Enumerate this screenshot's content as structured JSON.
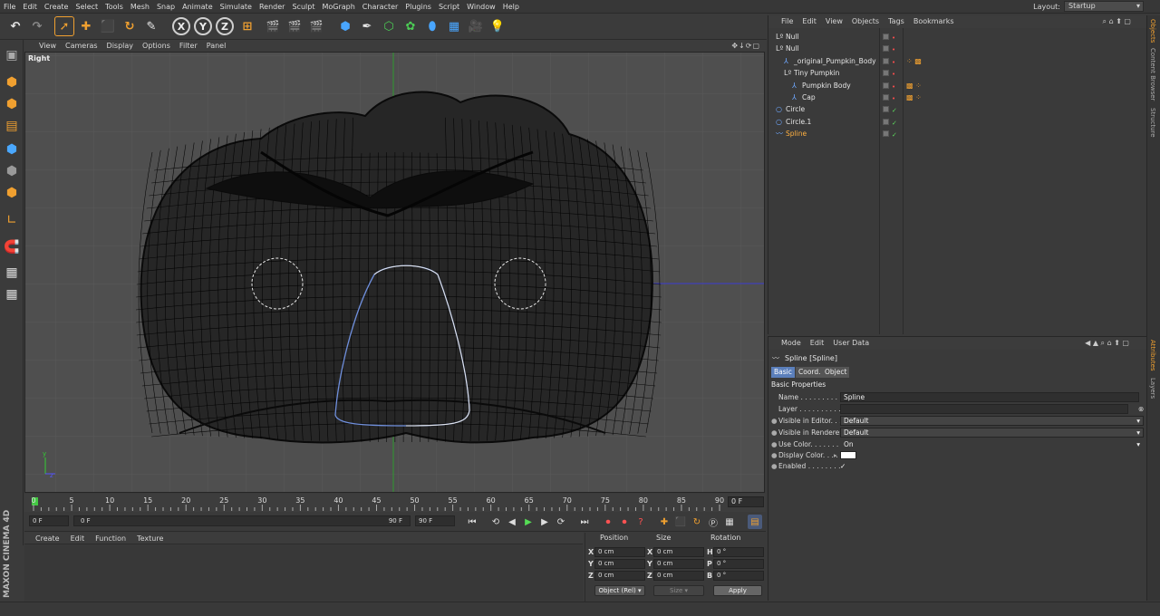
{
  "menubar": {
    "items": [
      "File",
      "Edit",
      "Create",
      "Select",
      "Tools",
      "Mesh",
      "Snap",
      "Animate",
      "Simulate",
      "Render",
      "Sculpt",
      "MoGraph",
      "Character",
      "Plugins",
      "Script",
      "Window",
      "Help"
    ],
    "layout_label": "Layout:",
    "layout_value": "Startup"
  },
  "toolbar": {
    "icons": [
      "undo-icon",
      "redo-icon",
      "select-icon",
      "move-icon",
      "scale-icon",
      "rotate-icon",
      "live-select-icon",
      "x-axis-icon",
      "y-axis-icon",
      "z-axis-icon",
      "coordinate-system-icon",
      "render-view-icon",
      "render-picture-viewer-icon",
      "edit-render-settings-icon",
      "cube-icon",
      "pen-spline-icon",
      "subdivision-icon",
      "array-icon",
      "deformer-icon",
      "floor-icon",
      "camera-icon",
      "light-icon"
    ],
    "x_label": "X",
    "y_label": "Y",
    "z_label": "Z"
  },
  "viewport": {
    "menu": [
      "View",
      "Cameras",
      "Display",
      "Options",
      "Filter",
      "Panel"
    ],
    "label": "Right"
  },
  "timeline": {
    "ticks": [
      "0",
      "5",
      "10",
      "15",
      "20",
      "25",
      "30",
      "35",
      "40",
      "45",
      "50",
      "55",
      "60",
      "65",
      "70",
      "75",
      "80",
      "85",
      "90"
    ],
    "current_frame": "0 F"
  },
  "transport": {
    "start": "0 F",
    "range_start": "0 F",
    "range_end": "90 F",
    "end": "90 F"
  },
  "material_manager": {
    "menu": [
      "Create",
      "Edit",
      "Function",
      "Texture"
    ]
  },
  "brand": {
    "text": "MAXON CINEMA 4D"
  },
  "coordinates": {
    "headers": [
      "Position",
      "Size",
      "Rotation"
    ],
    "rows": [
      {
        "axis": "X",
        "pos": "0 cm",
        "size_axis": "X",
        "size": "0 cm",
        "rot_axis": "H",
        "rot": "0 °"
      },
      {
        "axis": "Y",
        "pos": "0 cm",
        "size_axis": "Y",
        "size": "0 cm",
        "rot_axis": "P",
        "rot": "0 °"
      },
      {
        "axis": "Z",
        "pos": "0 cm",
        "size_axis": "Z",
        "size": "0 cm",
        "rot_axis": "B",
        "rot": "0 °"
      }
    ],
    "mode": "Object (Rel)",
    "size_mode": "Size",
    "apply": "Apply"
  },
  "object_manager": {
    "menu": [
      "File",
      "Edit",
      "View",
      "Objects",
      "Tags",
      "Bookmarks"
    ],
    "objects": [
      {
        "name": "Null",
        "depth": 0,
        "icon": "null"
      },
      {
        "name": "Null",
        "depth": 0,
        "icon": "null"
      },
      {
        "name": "_original_Pumpkin_Body",
        "depth": 1,
        "icon": "poly"
      },
      {
        "name": "Tiny Pumpkin",
        "depth": 1,
        "icon": "null"
      },
      {
        "name": "Pumpkin Body",
        "depth": 2,
        "icon": "poly"
      },
      {
        "name": "Cap",
        "depth": 2,
        "icon": "poly"
      },
      {
        "name": "Circle",
        "depth": 0,
        "icon": "circle"
      },
      {
        "name": "Circle.1",
        "depth": 0,
        "icon": "circle"
      },
      {
        "name": "Spline",
        "depth": 0,
        "icon": "spline"
      }
    ]
  },
  "attributes": {
    "menu": [
      "Mode",
      "Edit",
      "User Data"
    ],
    "title": "Spline [Spline]",
    "tabs": [
      "Basic",
      "Coord.",
      "Object"
    ],
    "section": "Basic Properties",
    "fields": [
      {
        "label": "Name . . . . . . . . . .",
        "value": "Spline"
      },
      {
        "label": "Layer . . . . . . . . . .",
        "value": ""
      },
      {
        "label": "Visible in Editor. . .",
        "value": "Default"
      },
      {
        "label": "Visible in Renderer",
        "value": "Default"
      },
      {
        "label": "Use Color. . . . . . . .",
        "value": "On"
      },
      {
        "label": "Display Color. . . . .",
        "value": ""
      },
      {
        "label": "Enabled . . . . . . . .",
        "value": "✓"
      }
    ]
  },
  "side_tabs": [
    "Objects",
    "Content Browser",
    "Structure",
    "Attributes",
    "Layers"
  ],
  "colors": {
    "accent": "#f0a030",
    "selection": "#5b7fbb",
    "spline": "#6f8fdc",
    "mesh": "#0a0a0a",
    "viewport_bg": "#4f4f4f"
  }
}
